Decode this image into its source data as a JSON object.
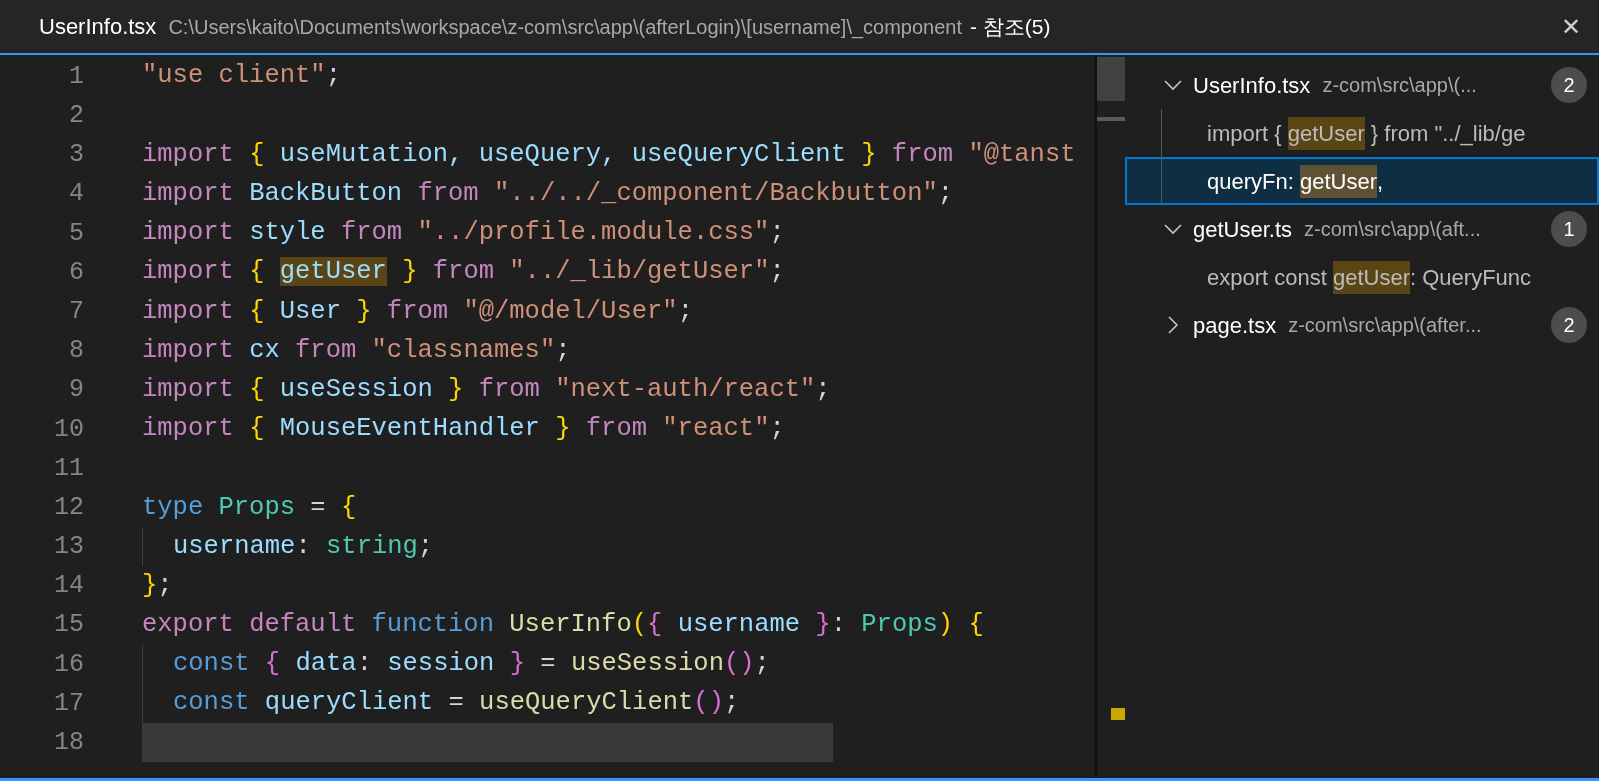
{
  "title_bar": {
    "file": "UserInfo.tsx",
    "path": "C:\\Users\\kaito\\Documents\\workspace\\z-com\\src\\app\\(afterLogin)\\[username]\\_component",
    "suffix": "- 참조(5)",
    "close": "✕"
  },
  "editor": {
    "lines": [
      {
        "number": "1",
        "current": false,
        "indented": false,
        "tokens": [
          {
            "text": "\"use client\"",
            "kind": "string"
          },
          {
            "text": ";",
            "kind": "punct"
          }
        ]
      },
      {
        "number": "2",
        "current": false,
        "indented": false
      },
      {
        "number": "3",
        "current": false,
        "indented": false,
        "tokens": [
          {
            "text": "import ",
            "kind": "keyword"
          },
          {
            "text": "{ ",
            "kind": "brace1"
          },
          {
            "text": "useMutation, ",
            "kind": "var"
          },
          {
            "text": "useQuery, ",
            "kind": "var"
          },
          {
            "text": "useQueryClient ",
            "kind": "var"
          },
          {
            "text": "} ",
            "kind": "brace1"
          },
          {
            "text": "from ",
            "kind": "keyword"
          },
          {
            "text": "\"@tanst",
            "kind": "string"
          }
        ]
      },
      {
        "number": "4",
        "current": false,
        "indented": false,
        "tokens": [
          {
            "text": "import ",
            "kind": "keyword"
          },
          {
            "text": "BackButton ",
            "kind": "var"
          },
          {
            "text": "from ",
            "kind": "keyword"
          },
          {
            "text": "\"../../_component/Backbutton\"",
            "kind": "string"
          },
          {
            "text": ";",
            "kind": "punct"
          }
        ]
      },
      {
        "number": "5",
        "current": false,
        "indented": false,
        "tokens": [
          {
            "text": "import ",
            "kind": "keyword"
          },
          {
            "text": "style ",
            "kind": "var"
          },
          {
            "text": "from ",
            "kind": "keyword"
          },
          {
            "text": "\"../profile.module.css\"",
            "kind": "string"
          },
          {
            "text": ";",
            "kind": "punct"
          }
        ]
      },
      {
        "number": "6",
        "current": false,
        "indented": false,
        "tokens": [
          {
            "text": "import ",
            "kind": "keyword"
          },
          {
            "text": "{ ",
            "kind": "brace1"
          },
          {
            "text": "getUser",
            "kind": "match"
          },
          {
            "text": " } ",
            "kind": "brace1"
          },
          {
            "text": "from ",
            "kind": "keyword"
          },
          {
            "text": "\"../_lib/getUser\"",
            "kind": "string"
          },
          {
            "text": ";",
            "kind": "punct"
          }
        ]
      },
      {
        "number": "7",
        "current": false,
        "indented": false,
        "tokens": [
          {
            "text": "import ",
            "kind": "keyword"
          },
          {
            "text": "{ ",
            "kind": "brace1"
          },
          {
            "text": "User ",
            "kind": "var"
          },
          {
            "text": "} ",
            "kind": "brace1"
          },
          {
            "text": "from ",
            "kind": "keyword"
          },
          {
            "text": "\"@/model/User\"",
            "kind": "string"
          },
          {
            "text": ";",
            "kind": "punct"
          }
        ]
      },
      {
        "number": "8",
        "current": false,
        "indented": false,
        "tokens": [
          {
            "text": "import ",
            "kind": "keyword"
          },
          {
            "text": "cx ",
            "kind": "var"
          },
          {
            "text": "from ",
            "kind": "keyword"
          },
          {
            "text": "\"classnames\"",
            "kind": "string"
          },
          {
            "text": ";",
            "kind": "punct"
          }
        ]
      },
      {
        "number": "9",
        "current": false,
        "indented": false,
        "tokens": [
          {
            "text": "import ",
            "kind": "keyword"
          },
          {
            "text": "{ ",
            "kind": "brace1"
          },
          {
            "text": "useSession ",
            "kind": "var"
          },
          {
            "text": "} ",
            "kind": "brace1"
          },
          {
            "text": "from ",
            "kind": "keyword"
          },
          {
            "text": "\"next-auth/react\"",
            "kind": "string"
          },
          {
            "text": ";",
            "kind": "punct"
          }
        ]
      },
      {
        "number": "10",
        "current": false,
        "indented": false,
        "tokens": [
          {
            "text": "import ",
            "kind": "keyword"
          },
          {
            "text": "{ ",
            "kind": "brace1"
          },
          {
            "text": "MouseEventHandler ",
            "kind": "var"
          },
          {
            "text": "} ",
            "kind": "brace1"
          },
          {
            "text": "from ",
            "kind": "keyword"
          },
          {
            "text": "\"react\"",
            "kind": "string"
          },
          {
            "text": ";",
            "kind": "punct"
          }
        ]
      },
      {
        "number": "11",
        "current": false,
        "indented": false
      },
      {
        "number": "12",
        "current": false,
        "indented": false,
        "tokens": [
          {
            "text": "type ",
            "kind": "storage"
          },
          {
            "text": "Props ",
            "kind": "type"
          },
          {
            "text": "= ",
            "kind": "punct"
          },
          {
            "text": "{",
            "kind": "brace1"
          }
        ]
      },
      {
        "number": "13",
        "current": false,
        "indented": true,
        "tokens": [
          {
            "text": "username",
            "kind": "var"
          },
          {
            "text": ": ",
            "kind": "punct"
          },
          {
            "text": "string",
            "kind": "type"
          },
          {
            "text": ";",
            "kind": "punct"
          }
        ]
      },
      {
        "number": "14",
        "current": false,
        "indented": false,
        "tokens": [
          {
            "text": "}",
            "kind": "brace1"
          },
          {
            "text": ";",
            "kind": "punct"
          }
        ]
      },
      {
        "number": "15",
        "current": false,
        "indented": false,
        "tokens": [
          {
            "text": "export ",
            "kind": "keyword"
          },
          {
            "text": "default ",
            "kind": "keyword"
          },
          {
            "text": "function ",
            "kind": "storage"
          },
          {
            "text": "UserInfo",
            "kind": "func"
          },
          {
            "text": "(",
            "kind": "brace1"
          },
          {
            "text": "{ ",
            "kind": "brace2"
          },
          {
            "text": "username ",
            "kind": "var"
          },
          {
            "text": "}",
            "kind": "brace2"
          },
          {
            "text": ": ",
            "kind": "punct"
          },
          {
            "text": "Props",
            "kind": "type"
          },
          {
            "text": ") ",
            "kind": "brace1"
          },
          {
            "text": "{",
            "kind": "brace1"
          }
        ]
      },
      {
        "number": "16",
        "current": false,
        "indented": true,
        "tokens": [
          {
            "text": "const ",
            "kind": "storage"
          },
          {
            "text": "{ ",
            "kind": "brace2"
          },
          {
            "text": "data",
            "kind": "var"
          },
          {
            "text": ": ",
            "kind": "punct"
          },
          {
            "text": "session ",
            "kind": "var"
          },
          {
            "text": "} ",
            "kind": "brace2"
          },
          {
            "text": "= ",
            "kind": "punct"
          },
          {
            "text": "useSession",
            "kind": "func"
          },
          {
            "text": "()",
            "kind": "brace2"
          },
          {
            "text": ";",
            "kind": "punct"
          }
        ]
      },
      {
        "number": "17",
        "current": false,
        "indented": true,
        "tokens": [
          {
            "text": "const ",
            "kind": "storage"
          },
          {
            "text": "queryClient ",
            "kind": "var"
          },
          {
            "text": "= ",
            "kind": "punct"
          },
          {
            "text": "useQueryClient",
            "kind": "func"
          },
          {
            "text": "()",
            "kind": "brace2"
          },
          {
            "text": ";",
            "kind": "punct"
          }
        ]
      },
      {
        "number": "18",
        "current": true,
        "indented": false
      }
    ]
  },
  "references": [
    {
      "file": "UserInfo.tsx",
      "path": "z-com\\src\\app\\(...",
      "count": "2",
      "expanded": true,
      "children": [
        {
          "selected": false,
          "segments": [
            {
              "text": "import { ",
              "kind": "text"
            },
            {
              "text": "getUser",
              "kind": "match"
            },
            {
              "text": " } from \"../_lib/ge",
              "kind": "text"
            }
          ]
        },
        {
          "selected": true,
          "segments": [
            {
              "text": "queryFn: ",
              "kind": "text"
            },
            {
              "text": "getUser",
              "kind": "match"
            },
            {
              "text": ",",
              "kind": "text"
            }
          ]
        }
      ]
    },
    {
      "file": "getUser.ts",
      "path": "z-com\\src\\app\\(aft...",
      "count": "1",
      "expanded": true,
      "children": [
        {
          "selected": false,
          "segments": [
            {
              "text": "export const ",
              "kind": "text"
            },
            {
              "text": "getUser",
              "kind": "match"
            },
            {
              "text": ": QueryFunc",
              "kind": "text"
            }
          ]
        }
      ]
    },
    {
      "file": "page.tsx",
      "path": "z-com\\src\\app\\(after...",
      "count": "2",
      "expanded": false
    }
  ]
}
